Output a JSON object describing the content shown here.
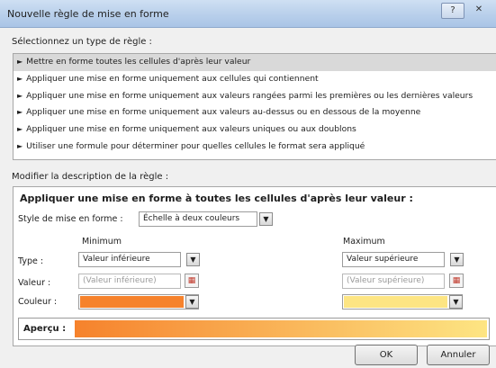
{
  "window": {
    "title": "Nouvelle règle de mise en forme",
    "help_glyph": "?",
    "close_glyph": "✕"
  },
  "rule_type": {
    "label": "Sélectionnez un type de règle :",
    "items": [
      {
        "label": "Mettre en forme toutes les cellules d'après leur valeur",
        "selected": true
      },
      {
        "label": "Appliquer une mise en forme uniquement aux cellules qui contiennent",
        "selected": false
      },
      {
        "label": "Appliquer une mise en forme uniquement aux valeurs rangées parmi les premières ou les dernières valeurs",
        "selected": false
      },
      {
        "label": "Appliquer une mise en forme uniquement aux valeurs au-dessus ou en dessous de la moyenne",
        "selected": false
      },
      {
        "label": "Appliquer une mise en forme uniquement aux valeurs uniques ou aux doublons",
        "selected": false
      },
      {
        "label": "Utiliser une formule pour déterminer pour quelles cellules le format sera appliqué",
        "selected": false
      }
    ]
  },
  "description": {
    "label": "Modifier la description de la règle :",
    "heading": "Appliquer une mise en forme à toutes les cellules d'après leur valeur :",
    "style_label": "Style de mise en forme :",
    "style_value": "Échelle à deux couleurs",
    "minimum_header": "Minimum",
    "maximum_header": "Maximum",
    "type_label": "Type :",
    "value_label": "Valeur :",
    "color_label": "Couleur :",
    "min_type": "Valeur inférieure",
    "max_type": "Valeur supérieure",
    "min_value": "(Valeur inférieure)",
    "max_value": "(Valeur supérieure)",
    "min_color": "#f6822c",
    "max_color": "#fde583",
    "preview_label": "Aperçu :"
  },
  "buttons": {
    "ok": "OK",
    "cancel": "Annuler"
  },
  "icons": {
    "dropdown": "▼",
    "triangle": "►",
    "cell_picker": "▦"
  }
}
